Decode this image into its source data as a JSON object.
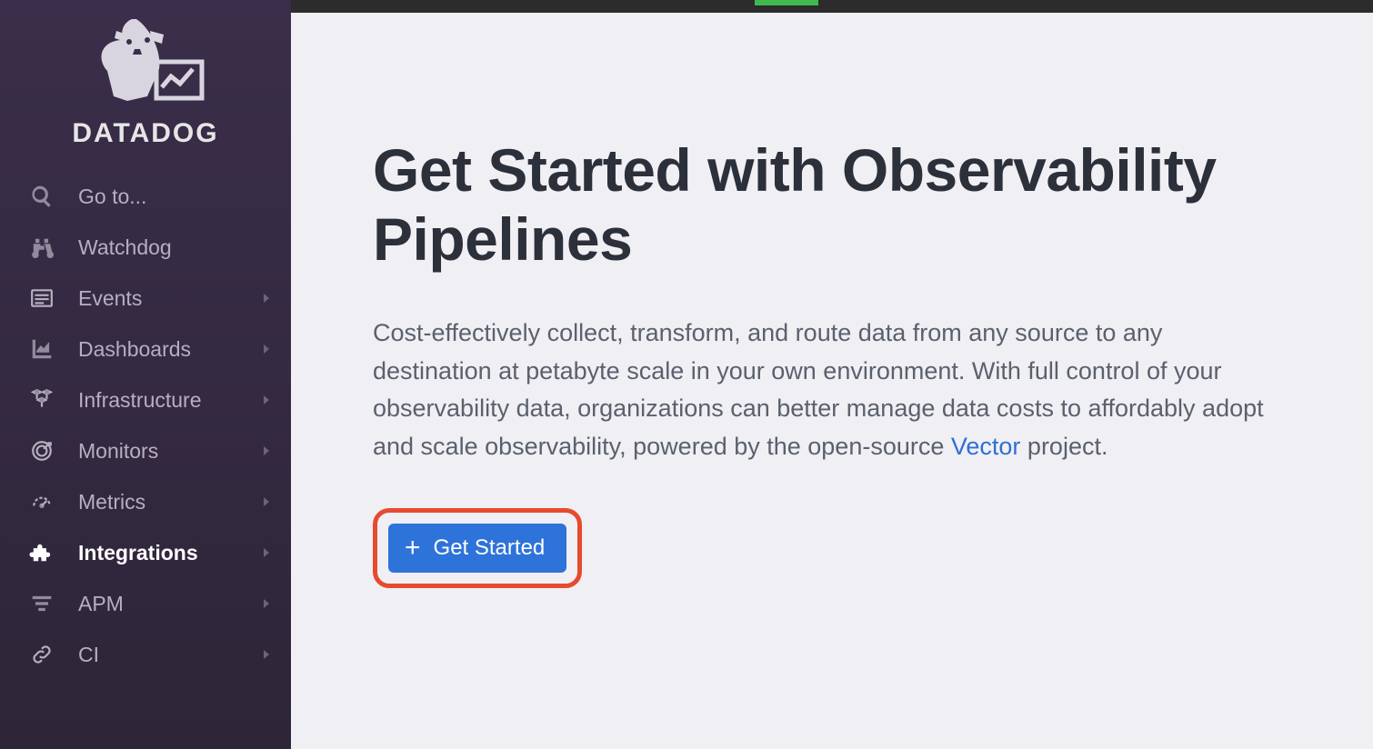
{
  "brand": "DATADOG",
  "sidebar": {
    "items": [
      {
        "label": "Go to...",
        "icon": "search",
        "chevron": false
      },
      {
        "label": "Watchdog",
        "icon": "binoculars",
        "chevron": false
      },
      {
        "label": "Events",
        "icon": "list",
        "chevron": true
      },
      {
        "label": "Dashboards",
        "icon": "chart",
        "chevron": true
      },
      {
        "label": "Infrastructure",
        "icon": "hex",
        "chevron": true
      },
      {
        "label": "Monitors",
        "icon": "target",
        "chevron": true
      },
      {
        "label": "Metrics",
        "icon": "gauge",
        "chevron": true
      },
      {
        "label": "Integrations",
        "icon": "puzzle",
        "chevron": true,
        "active": true
      },
      {
        "label": "APM",
        "icon": "filter",
        "chevron": true
      },
      {
        "label": "CI",
        "icon": "link",
        "chevron": true
      }
    ]
  },
  "main": {
    "headline": "Get Started with Observability Pipelines",
    "body_pre": "Cost-effectively collect, transform, and route data from any source to any destination at petabyte scale in your own environment. With full control of your observability data, organizations can better manage data costs to affordably adopt and scale observability, powered by the open-source ",
    "body_link": "Vector",
    "body_post": " project.",
    "cta_label": "Get Started"
  },
  "colors": {
    "accent_blue": "#2e73d9",
    "highlight_red": "#e64b2f",
    "link_blue": "#2f6fd6"
  }
}
